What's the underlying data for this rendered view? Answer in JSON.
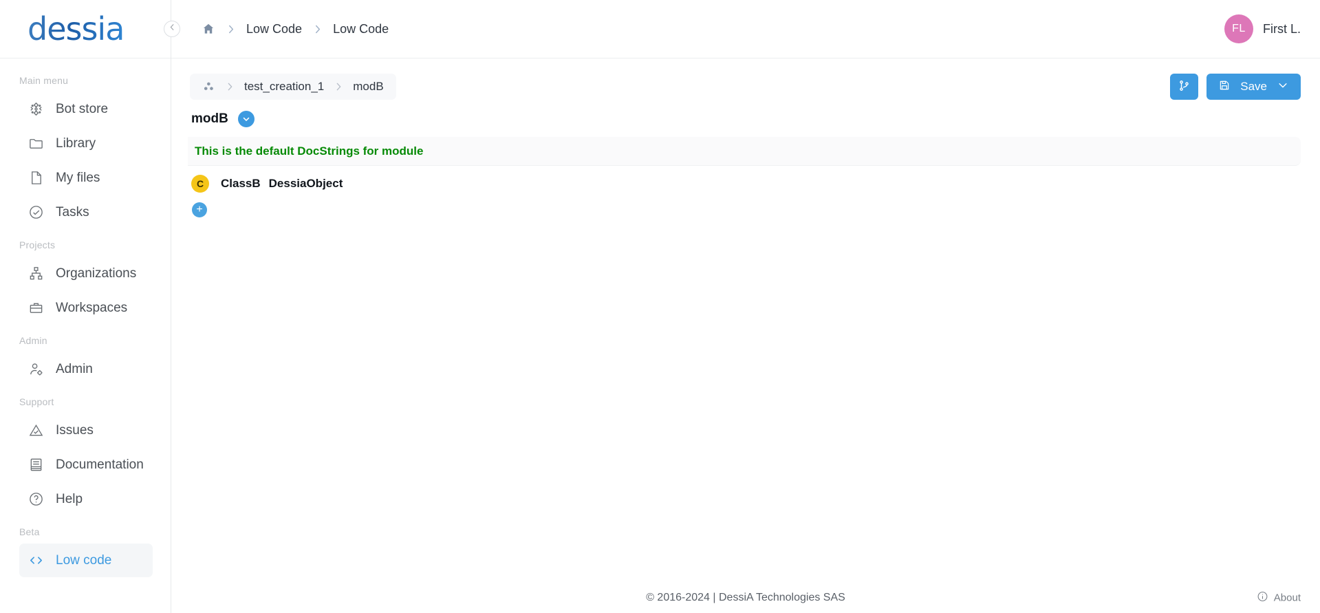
{
  "brand": {
    "logo_text": "dessia",
    "logo_color": "#1e5ea8"
  },
  "sidebar": {
    "collapse_icon": "chevron-left-icon",
    "sections": [
      {
        "label": "Main menu",
        "items": [
          {
            "label": "Bot store",
            "icon": "bot-store-icon",
            "active": false
          },
          {
            "label": "Library",
            "icon": "folder-icon",
            "active": false
          },
          {
            "label": "My files",
            "icon": "file-icon",
            "active": false
          },
          {
            "label": "Tasks",
            "icon": "check-circle-icon",
            "active": false
          }
        ]
      },
      {
        "label": "Projects",
        "items": [
          {
            "label": "Organizations",
            "icon": "org-chart-icon",
            "active": false
          },
          {
            "label": "Workspaces",
            "icon": "briefcase-icon",
            "active": false
          }
        ]
      },
      {
        "label": "Admin",
        "items": [
          {
            "label": "Admin",
            "icon": "user-cog-icon",
            "active": false
          }
        ]
      },
      {
        "label": "Support",
        "items": [
          {
            "label": "Issues",
            "icon": "warning-triangle-icon",
            "active": false
          },
          {
            "label": "Documentation",
            "icon": "book-icon",
            "active": false
          },
          {
            "label": "Help",
            "icon": "question-circle-icon",
            "active": false
          }
        ]
      },
      {
        "label": "Beta",
        "items": [
          {
            "label": "Low code",
            "icon": "code-brackets-icon",
            "active": true
          }
        ]
      }
    ]
  },
  "topbar": {
    "home_icon": "home-icon",
    "breadcrumb": [
      "Low Code",
      "Low Code"
    ],
    "user": {
      "initials": "FL",
      "name": "First L.",
      "avatar_color": "#dd77b8"
    }
  },
  "content": {
    "module_breadcrumb": {
      "icon": "cubes-icon",
      "items": [
        "test_creation_1",
        "modB"
      ]
    },
    "actions": {
      "branch_button": {
        "icon": "git-branch-icon"
      },
      "save_button": {
        "icon": "floppy-disk-icon",
        "label": "Save",
        "dropdown_icon": "chevron-down-icon"
      }
    },
    "module": {
      "title": "modB",
      "toggle_icon": "chevron-down-circle-icon",
      "docstring": "This is the default DocStrings for module",
      "docstring_color": "#068a06",
      "classes": [
        {
          "badge": "C",
          "name": "ClassB",
          "base": "DessiaObject",
          "badge_color": "#f5c518"
        }
      ],
      "add_button": {
        "icon": "plus-icon",
        "label": "+"
      }
    }
  },
  "footer": {
    "copyright": "© 2016-2024 | DessiA Technologies SAS",
    "about": {
      "icon": "info-circle-icon",
      "label": "About"
    }
  }
}
